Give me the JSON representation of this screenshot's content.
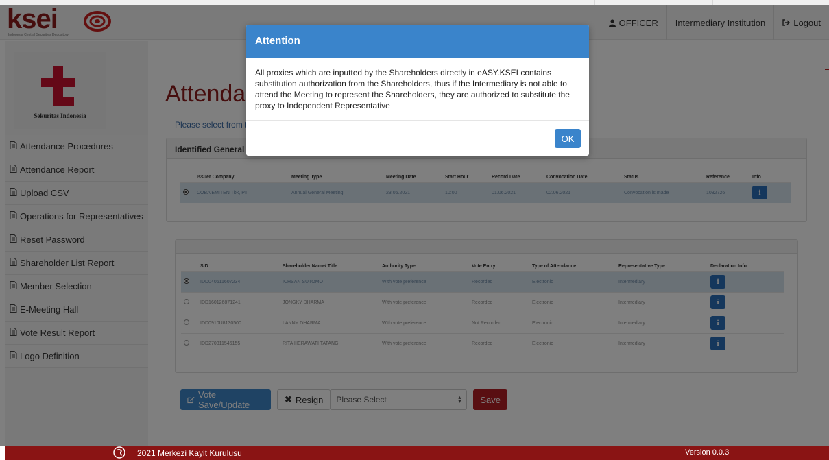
{
  "header": {
    "logo_text": "ksei",
    "logo_sub": "Indonesia Central Securities Depository",
    "nav": {
      "officer": "OFFICER",
      "institution": "Intermediary Institution",
      "logout": "Logout"
    }
  },
  "sidebar": {
    "brand_caption": "Sekuritas Indonesia",
    "items": [
      {
        "label": "Attendance Procedures"
      },
      {
        "label": "Attendance Report"
      },
      {
        "label": "Upload CSV"
      },
      {
        "label": "Operations for Representatives"
      },
      {
        "label": "Reset Password"
      },
      {
        "label": "Shareholder List Report"
      },
      {
        "label": "Member Selection"
      },
      {
        "label": "E-Meeting Hall"
      },
      {
        "label": "Vote Result Report"
      },
      {
        "label": "Logo Definition"
      }
    ]
  },
  "main": {
    "title": "Attenda",
    "subtitle": "Please select from t",
    "meetings_panel_title": "Identified General",
    "meetings": {
      "columns": [
        "Issuer Company",
        "Meeting Type",
        "Meeting Date",
        "Start Hour",
        "Record Date",
        "Convocation Date",
        "Status",
        "Reference",
        "Info"
      ],
      "rows": [
        {
          "issuer": "COBA EMITEN Tbk, PT",
          "type": "Annual General Meeting",
          "date": "23.06.2021",
          "hour": "10:00",
          "record": "01.06.2021",
          "convocation": "02.06.2021",
          "status": "Convocation is made",
          "reference": "1032726",
          "selected": true
        }
      ]
    },
    "shareholders": {
      "columns": [
        "SID",
        "Shareholder Name/ Title",
        "Authority Type",
        "Vote Entry",
        "Type of Attendance",
        "Representative Type",
        "Declaration Info"
      ],
      "rows": [
        {
          "sid": "IDD040611607234",
          "name": "ICHSAN SUTOMO",
          "authority": "With vote preference",
          "vote": "Recorded",
          "attendance": "Electronic",
          "rep": "Intermediary",
          "selected": true
        },
        {
          "sid": "IDD160126871241",
          "name": "JONGKY DHARMA",
          "authority": "With vote preference",
          "vote": "Recorded",
          "attendance": "Electronic",
          "rep": "Intermediary",
          "selected": false
        },
        {
          "sid": "IDD0910U8130500",
          "name": "LANNY DHARMA",
          "authority": "With vote preference",
          "vote": "Not Recorded",
          "attendance": "Electronic",
          "rep": "Intermediary",
          "selected": false
        },
        {
          "sid": "IDD270311546155",
          "name": "RITA HERAWATI TATANG",
          "authority": "With vote preference",
          "vote": "Recorded",
          "attendance": "Electronic",
          "rep": "Intermediary",
          "selected": false
        }
      ]
    },
    "actions": {
      "vote_save": "Vote Save/Update",
      "resign": "Resign",
      "select_placeholder": "Please Select",
      "save": "Save"
    }
  },
  "modal": {
    "title": "Attention",
    "body": "All proxies which are inputted by the Shareholders directly in eASY.KSEI contains substitution authorization from the Shareholders, thus if the Intermediary is not able to attend the Meeting to represent the Shareholders, they are authorized to substitute the proxy to Independent Representative",
    "ok": "OK"
  },
  "footer": {
    "copyright": "2021 Merkezi Kayit Kurulusu",
    "version": "Version 0.0.3"
  },
  "colors": {
    "brand_red": "#8c1d1d",
    "modal_blue": "#3a84cb",
    "footer_red": "#8a1414"
  }
}
